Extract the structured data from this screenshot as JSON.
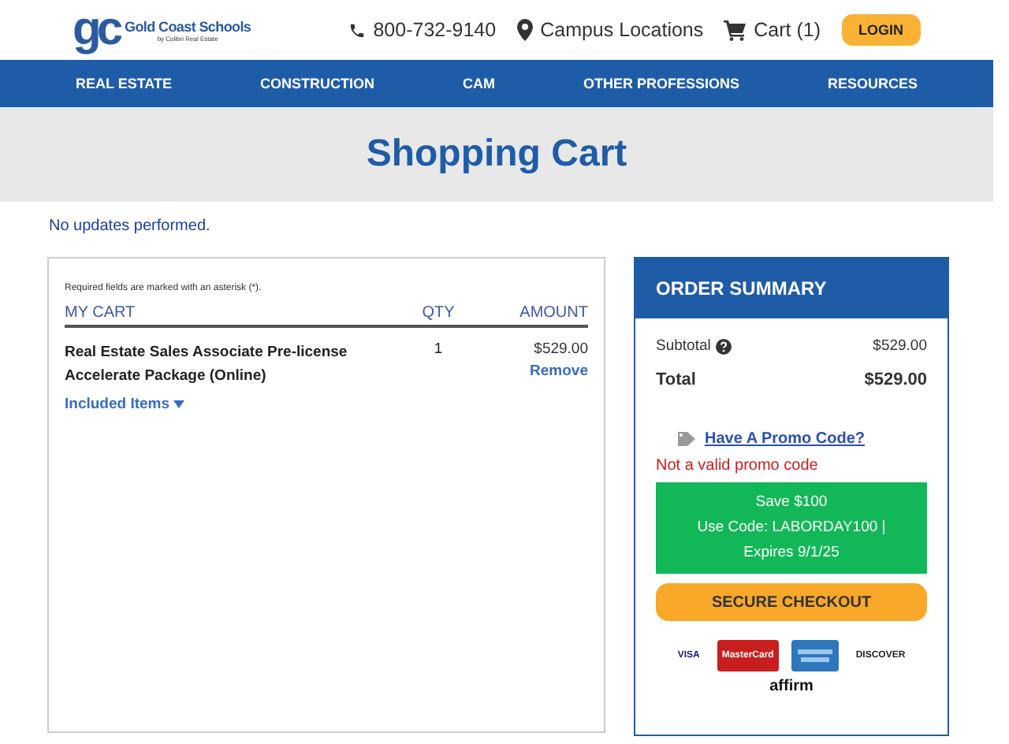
{
  "logo": {
    "mark": "gc",
    "name": "Gold Coast Schools",
    "tagline": "by Colibri Real Estate"
  },
  "header": {
    "phone": "800-732-9140",
    "locations": "Campus Locations",
    "cart": "Cart (1)",
    "login": "LOGIN"
  },
  "nav": [
    "REAL ESTATE",
    "CONSTRUCTION",
    "CAM",
    "OTHER PROFESSIONS",
    "RESOURCES"
  ],
  "page_title": "Shopping Cart",
  "notice": "No updates performed.",
  "cart": {
    "required_note": "Required fields are marked with an asterisk (*).",
    "columns": [
      "MY CART",
      "QTY",
      "AMOUNT"
    ],
    "items": [
      {
        "name": "Real Estate Sales Associate Pre-license Accelerate Package (Online)",
        "qty": "1",
        "amount": "$529.00",
        "remove": "Remove",
        "included": "Included Items",
        "expanded": false
      }
    ]
  },
  "summary": {
    "title": "ORDER SUMMARY",
    "subtotal_label": "Subtotal",
    "subtotal": "$529.00",
    "total_label": "Total",
    "total": "$529.00",
    "promo_link": "Have A Promo Code?",
    "promo_error": "Not a valid promo code",
    "promo_banner": [
      "Save $100",
      "Use Code: LABORDAY100 | Expires 9/1/25"
    ],
    "checkout": "SECURE CHECKOUT",
    "cards": [
      {
        "kind": "visa",
        "label": "VISA"
      },
      {
        "kind": "mastercard",
        "label": "MasterCard"
      },
      {
        "kind": "amex"
      },
      {
        "kind": "discover",
        "label": "DISCOVER"
      },
      {
        "kind": "affirm",
        "label": "affirm"
      }
    ]
  }
}
